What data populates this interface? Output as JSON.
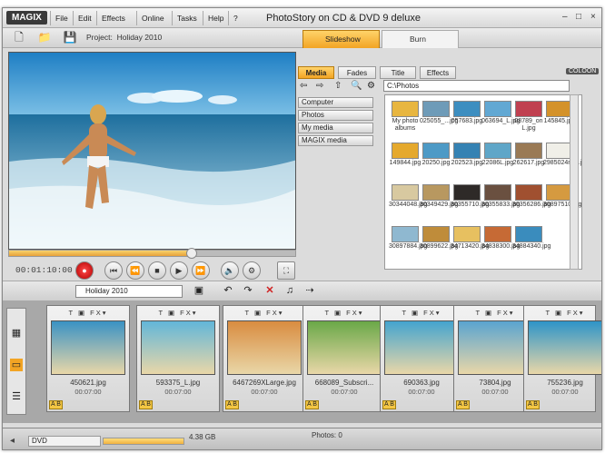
{
  "app": {
    "logo": "MAGIX",
    "title": "PhotoStory on CD & DVD 9 deluxe",
    "menu": [
      "File",
      "Edit",
      "Effects",
      "Online",
      "Tasks",
      "Help"
    ],
    "window_buttons": {
      "minimize": "–",
      "maximize": "□",
      "close": "×"
    }
  },
  "toolbar": {
    "project_label": "Project:",
    "project_name": "Holiday 2010",
    "mode_tabs": {
      "slideshow": "Slideshow",
      "burn": "Burn"
    }
  },
  "player": {
    "timecode": "00:01:10:00",
    "progress_fraction": 0.64
  },
  "media": {
    "tabs": [
      "Media",
      "Fades",
      "Title",
      "Effects"
    ],
    "brand": "COLOON",
    "path": "C:\\Photos",
    "categories": [
      "Computer",
      "Photos",
      "My media",
      "MAGIX media"
    ],
    "files": [
      {
        "name": "My photo albums",
        "color": "#e8b640"
      },
      {
        "name": "025055_...jpg",
        "color": "#6e9bb8"
      },
      {
        "name": "057683.jpg",
        "color": "#3d8ec0"
      },
      {
        "name": "063694_L.jpg",
        "color": "#62a8d3"
      },
      {
        "name": "08789_on L.jpg",
        "color": "#c04050"
      },
      {
        "name": "145845.jpg",
        "color": "#d4922a"
      },
      {
        "name": "149844.jpg",
        "color": "#e5a92d"
      },
      {
        "name": "20250.jpg",
        "color": "#4d9ac6"
      },
      {
        "name": "202523.jpg",
        "color": "#3582b3"
      },
      {
        "name": "22086L.jpg",
        "color": "#5fa6c8"
      },
      {
        "name": "262617.jpg",
        "color": "#9a7a55"
      },
      {
        "name": "2985024n_L.jpg",
        "color": "#f0efe8"
      },
      {
        "name": "30344048.jpg",
        "color": "#d8c9a0"
      },
      {
        "name": "30349429.jpg",
        "color": "#b89860"
      },
      {
        "name": "30355710.jpg",
        "color": "#2e2a28"
      },
      {
        "name": "30355833.jpg",
        "color": "#6a5040"
      },
      {
        "name": "30356286.jpg",
        "color": "#a05030"
      },
      {
        "name": "30897510.jpg",
        "color": "#d59a40"
      },
      {
        "name": "30897884.jpg",
        "color": "#8fb8d0"
      },
      {
        "name": "30899622.jpg",
        "color": "#bf8c3a"
      },
      {
        "name": "34713420.jpg",
        "color": "#e7c060"
      },
      {
        "name": "34838300.jpg",
        "color": "#c66a35"
      },
      {
        "name": "34884340.jpg",
        "color": "#3a8cbd"
      }
    ]
  },
  "storyboard": {
    "project_select": "Holiday 2010",
    "side_tabs": [
      "storyboard",
      "timeline",
      "list"
    ],
    "clips": [
      {
        "name": "450621.jpg",
        "duration": "00:07:00",
        "color": "#3a92c4"
      },
      {
        "name": "593375_L.jpg",
        "duration": "00:07:00",
        "color": "#62b6d9"
      },
      {
        "name": "6467269XLarge.jpg",
        "duration": "00:07:00",
        "color": "#d98c40"
      },
      {
        "name": "668089_Subscri...",
        "duration": "00:07:00",
        "color": "#6aa848"
      },
      {
        "name": "690363.jpg",
        "duration": "00:07:00",
        "color": "#44a4cf"
      },
      {
        "name": "73804.jpg",
        "duration": "00:07:00",
        "color": "#5aa4d0"
      },
      {
        "name": "755236.jpg",
        "duration": "00:07:00",
        "color": "#2e94c8"
      }
    ]
  },
  "status": {
    "format": "DVD",
    "size": "4.38 GB",
    "photos": "Photos: 0",
    "capacity_fraction": 0.6
  },
  "accent": "#f2a424"
}
